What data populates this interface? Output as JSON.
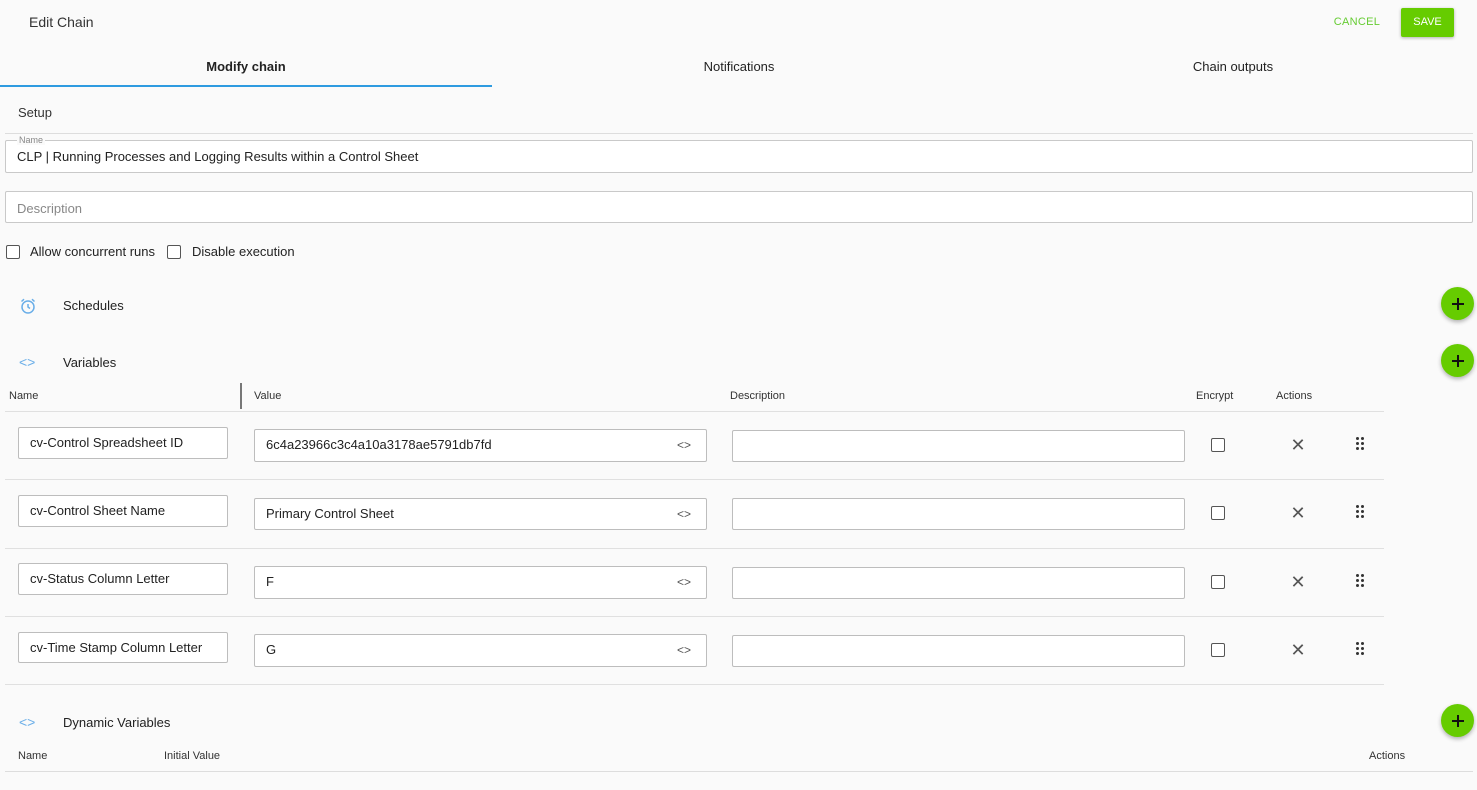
{
  "header": {
    "title": "Edit Chain",
    "cancel_label": "CANCEL",
    "save_label": "SAVE"
  },
  "tabs": [
    {
      "label": "Modify chain",
      "active": true
    },
    {
      "label": "Notifications",
      "active": false
    },
    {
      "label": "Chain outputs",
      "active": false
    }
  ],
  "setup": {
    "heading": "Setup",
    "name_label": "Name",
    "name_value": "CLP | Running Processes and Logging Results within a Control Sheet",
    "description_placeholder": "Description",
    "allow_concurrent_label": "Allow concurrent runs",
    "disable_execution_label": "Disable execution"
  },
  "schedules": {
    "label": "Schedules",
    "icon": "alarm-clock-icon"
  },
  "variables": {
    "label": "Variables",
    "icon": "code-brackets-icon",
    "columns": {
      "name": "Name",
      "value": "Value",
      "description": "Description",
      "encrypt": "Encrypt",
      "actions": "Actions"
    },
    "rows": [
      {
        "name": "cv-Control Spreadsheet ID",
        "value": "6c4a23966c3c4a10a3178ae5791db7fd",
        "description": ""
      },
      {
        "name": "cv-Control Sheet Name",
        "value": "Primary Control Sheet",
        "description": ""
      },
      {
        "name": "cv-Status Column Letter",
        "value": "F",
        "description": ""
      },
      {
        "name": "cv-Time Stamp Column Letter",
        "value": "G",
        "description": ""
      }
    ]
  },
  "dynamic_variables": {
    "label": "Dynamic Variables",
    "icon": "code-brackets-icon",
    "columns": {
      "name": "Name",
      "initial_value": "Initial Value",
      "actions": "Actions"
    }
  },
  "colors": {
    "accent_green": "#66cc00",
    "tab_underline": "#2e9be0",
    "icon_blue": "#6aaee8"
  },
  "code_glyph": "<>"
}
